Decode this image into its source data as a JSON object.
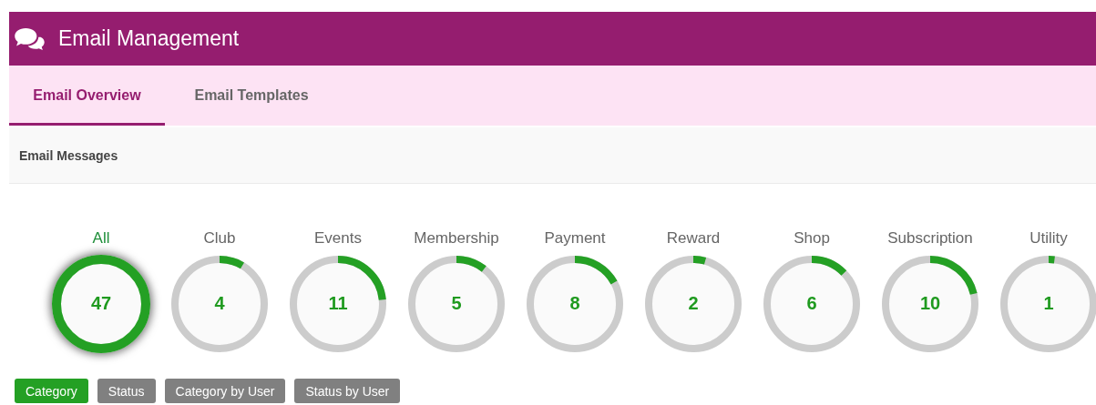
{
  "header": {
    "title": "Email Management"
  },
  "tabs": [
    {
      "label": "Email Overview",
      "selected": true
    },
    {
      "label": "Email Templates",
      "selected": false
    }
  ],
  "section": {
    "title": "Email Messages"
  },
  "categories": [
    {
      "label": "All",
      "count": "47",
      "level": 1,
      "selected": true
    },
    {
      "label": "Club",
      "count": "4",
      "level": 0.085,
      "selected": false
    },
    {
      "label": "Events",
      "count": "11",
      "level": 0.234,
      "selected": false
    },
    {
      "label": "Membership",
      "count": "5",
      "level": 0.106,
      "selected": false
    },
    {
      "label": "Payment",
      "count": "8",
      "level": 0.17,
      "selected": false
    },
    {
      "label": "Reward",
      "count": "2",
      "level": 0.043,
      "selected": false
    },
    {
      "label": "Shop",
      "count": "6",
      "level": 0.128,
      "selected": false
    },
    {
      "label": "Subscription",
      "count": "10",
      "level": 0.213,
      "selected": false
    },
    {
      "label": "Utility",
      "count": "1",
      "level": 0.021,
      "selected": false
    }
  ],
  "view_buttons": [
    {
      "label": "Category",
      "selected": true
    },
    {
      "label": "Status",
      "selected": false
    },
    {
      "label": "Category by User",
      "selected": false
    },
    {
      "label": "Status by User",
      "selected": false
    }
  ]
}
